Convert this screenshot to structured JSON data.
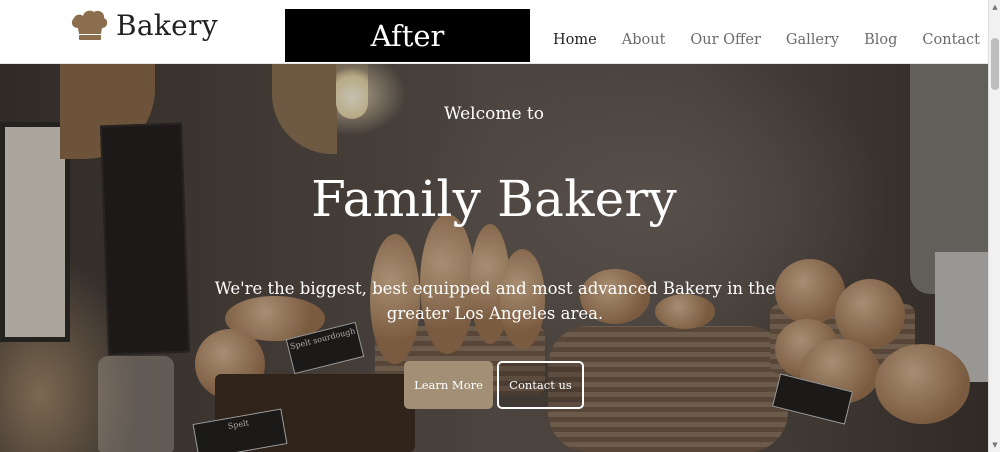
{
  "header": {
    "logo_text": "Bakery",
    "overlay_label": "After",
    "nav": [
      {
        "label": "Home",
        "active": true
      },
      {
        "label": "About",
        "active": false
      },
      {
        "label": "Our Offer",
        "active": false
      },
      {
        "label": "Gallery",
        "active": false
      },
      {
        "label": "Blog",
        "active": false
      },
      {
        "label": "Contact",
        "active": false
      }
    ]
  },
  "hero": {
    "welcome": "Welcome to",
    "title": "Family Bakery",
    "tagline": "We're the biggest, best equipped and most advanced Bakery in the greater Los Angeles area.",
    "buttons": {
      "learn_more": "Learn More",
      "contact_us": "Contact us"
    },
    "photo_signs": {
      "sign1": "Spelt sourdough",
      "sign2": "Spelt"
    }
  },
  "colors": {
    "accent": "#a38f75",
    "logo": "#8b6e4e"
  }
}
